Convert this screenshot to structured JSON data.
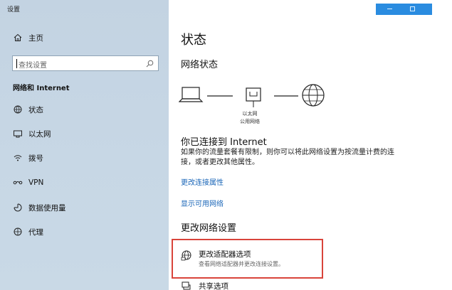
{
  "app": {
    "title": "设置"
  },
  "sidebar": {
    "home_label": "主页",
    "search_placeholder": "查找设置",
    "section_label": "网络和 Internet",
    "items": [
      {
        "label": "状态",
        "icon": "globe-status-icon"
      },
      {
        "label": "以太网",
        "icon": "ethernet-icon"
      },
      {
        "label": "拨号",
        "icon": "dialup-icon"
      },
      {
        "label": "VPN",
        "icon": "vpn-icon"
      },
      {
        "label": "数据使用量",
        "icon": "data-usage-icon"
      },
      {
        "label": "代理",
        "icon": "proxy-globe-icon"
      }
    ]
  },
  "main": {
    "title": "状态",
    "network_status_heading": "网络状态",
    "diagram": {
      "adapter_name": "以太网",
      "network_type": "公用网络"
    },
    "connected_text": "你已连接到 Internet",
    "description": "如果你的流量套餐有限制，则你可以将此网络设置为按流量计费的连接，或者更改其他属性。",
    "link_change_properties": "更改连接属性",
    "link_show_networks": "显示可用网络",
    "change_settings_heading": "更改网络设置",
    "options": [
      {
        "title": "更改适配器选项",
        "description": "查看网络适配器并更改连接设置。",
        "icon": "adapter-globe-icon"
      },
      {
        "title": "共享选项",
        "icon": "sharing-icon"
      }
    ]
  },
  "colors": {
    "sidebar_bg": "#c7d7e5",
    "link": "#1a66b8",
    "highlight_border": "#d9443b",
    "window_controls": "#2a8ce0"
  }
}
